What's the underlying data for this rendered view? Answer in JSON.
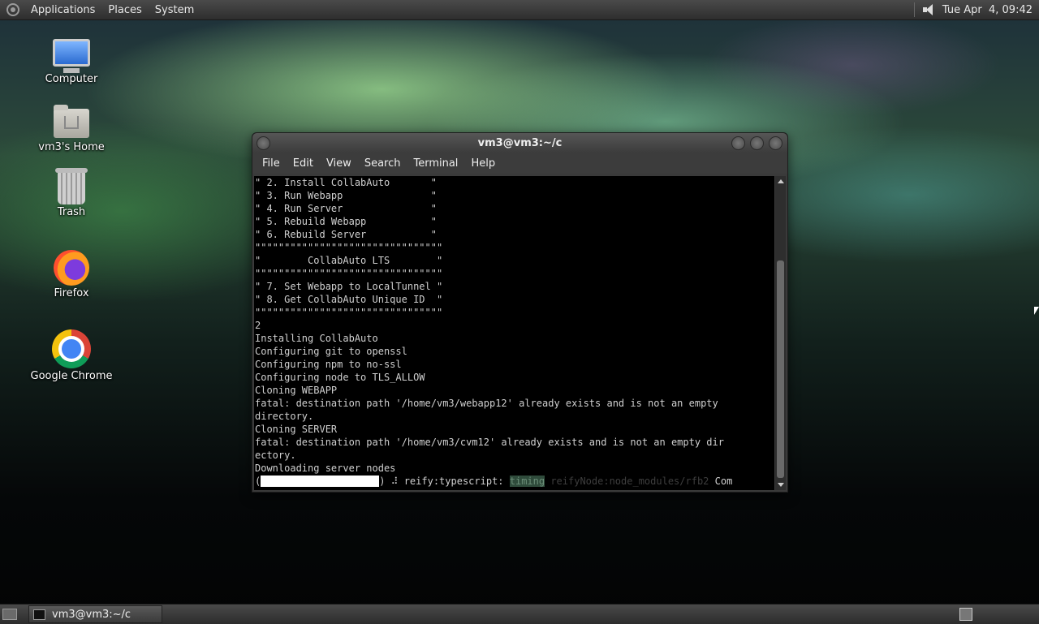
{
  "top_panel": {
    "menus": [
      "Applications",
      "Places",
      "System"
    ],
    "clock": "Tue Apr  4, 09:42"
  },
  "desktop": {
    "icons": [
      {
        "label": "Computer",
        "icon": "computer-icon"
      },
      {
        "label": "vm3's Home",
        "icon": "home-folder-icon"
      },
      {
        "label": "Trash",
        "icon": "trash-icon"
      },
      {
        "label": "Firefox",
        "icon": "firefox-icon"
      },
      {
        "label": "Google Chrome",
        "icon": "chrome-icon"
      }
    ]
  },
  "terminal": {
    "title": "vm3@vm3:~/c",
    "menus": [
      "File",
      "Edit",
      "View",
      "Search",
      "Terminal",
      "Help"
    ],
    "lines": [
      "\" 2. Install CollabAuto       \"",
      "\" 3. Run Webapp               \"",
      "\" 4. Run Server               \"",
      "\" 5. Rebuild Webapp           \"",
      "\" 6. Rebuild Server           \"",
      "\"\"\"\"\"\"\"\"\"\"\"\"\"\"\"\"\"\"\"\"\"\"\"\"\"\"\"\"\"\"\"\"",
      "\"        CollabAuto LTS        \"",
      "\"\"\"\"\"\"\"\"\"\"\"\"\"\"\"\"\"\"\"\"\"\"\"\"\"\"\"\"\"\"\"\"",
      "\" 7. Set Webapp to LocalTunnel \"",
      "\" 8. Get CollabAuto Unique ID  \"",
      "\"\"\"\"\"\"\"\"\"\"\"\"\"\"\"\"\"\"\"\"\"\"\"\"\"\"\"\"\"\"\"\"",
      "2",
      "Installing CollabAuto",
      "Configuring git to openssl",
      "Configuring npm to no-ssl",
      "Configuring node to TLS_ALLOW",
      "Cloning WEBAPP",
      "fatal: destination path '/home/vm3/webapp12' already exists and is not an empty",
      "directory.",
      "Cloning SERVER",
      "fatal: destination path '/home/vm3/cvm12' already exists and is not an empty dir",
      "ectory.",
      "Downloading server nodes"
    ],
    "progress_line": {
      "open": "(",
      "close": ") ⠼ reify:typescript: ",
      "timing": "timing",
      "dim_text": " reifyNode:node_modules/rfb2",
      "tail": " Com"
    }
  },
  "bottom_panel": {
    "task_label": "vm3@vm3:~/c"
  }
}
